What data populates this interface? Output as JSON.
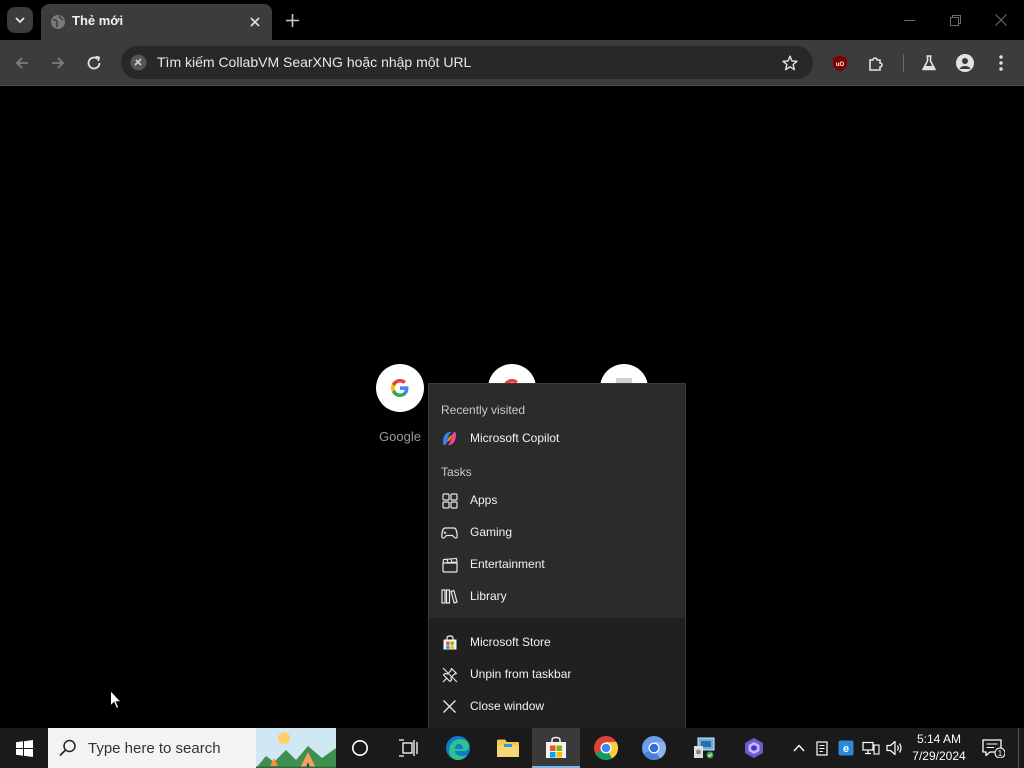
{
  "browser": {
    "tab": {
      "title": "Thẻ mới"
    },
    "omnibox": {
      "placeholder": "Tìm kiếm CollabVM SearXNG hoặc nhập một URL"
    },
    "colors": {
      "frame": "#000000",
      "toolbar": "#3c3c3c",
      "omnibox": "#282828"
    }
  },
  "ntp": {
    "shortcuts": [
      {
        "label": "Google",
        "icon": "google-icon"
      },
      {
        "label": "",
        "icon": "google-icon"
      },
      {
        "label": "",
        "icon": "web-store-icon"
      }
    ]
  },
  "jumplist": {
    "recent_header": "Recently visited",
    "recent_items": [
      {
        "label": "Microsoft Copilot",
        "icon": "copilot-icon"
      }
    ],
    "tasks_header": "Tasks",
    "tasks": [
      {
        "label": "Apps",
        "icon": "apps-icon"
      },
      {
        "label": "Gaming",
        "icon": "gamepad-icon"
      },
      {
        "label": "Entertainment",
        "icon": "clapperboard-icon"
      },
      {
        "label": "Library",
        "icon": "library-icon"
      }
    ],
    "actions": [
      {
        "label": "Microsoft Store",
        "icon": "store-icon"
      },
      {
        "label": "Unpin from taskbar",
        "icon": "unpin-icon"
      },
      {
        "label": "Close window",
        "icon": "close-icon"
      }
    ]
  },
  "taskbar": {
    "search_placeholder": "Type here to search",
    "apps": [
      "cortana",
      "task-view",
      "edge",
      "file-explorer",
      "microsoft-store",
      "chrome",
      "chromium",
      "control-panel",
      "copilot"
    ],
    "clock": {
      "time": "5:14 AM",
      "date": "7/29/2024"
    },
    "notification_count": "1",
    "accent": "#76b9ed"
  }
}
